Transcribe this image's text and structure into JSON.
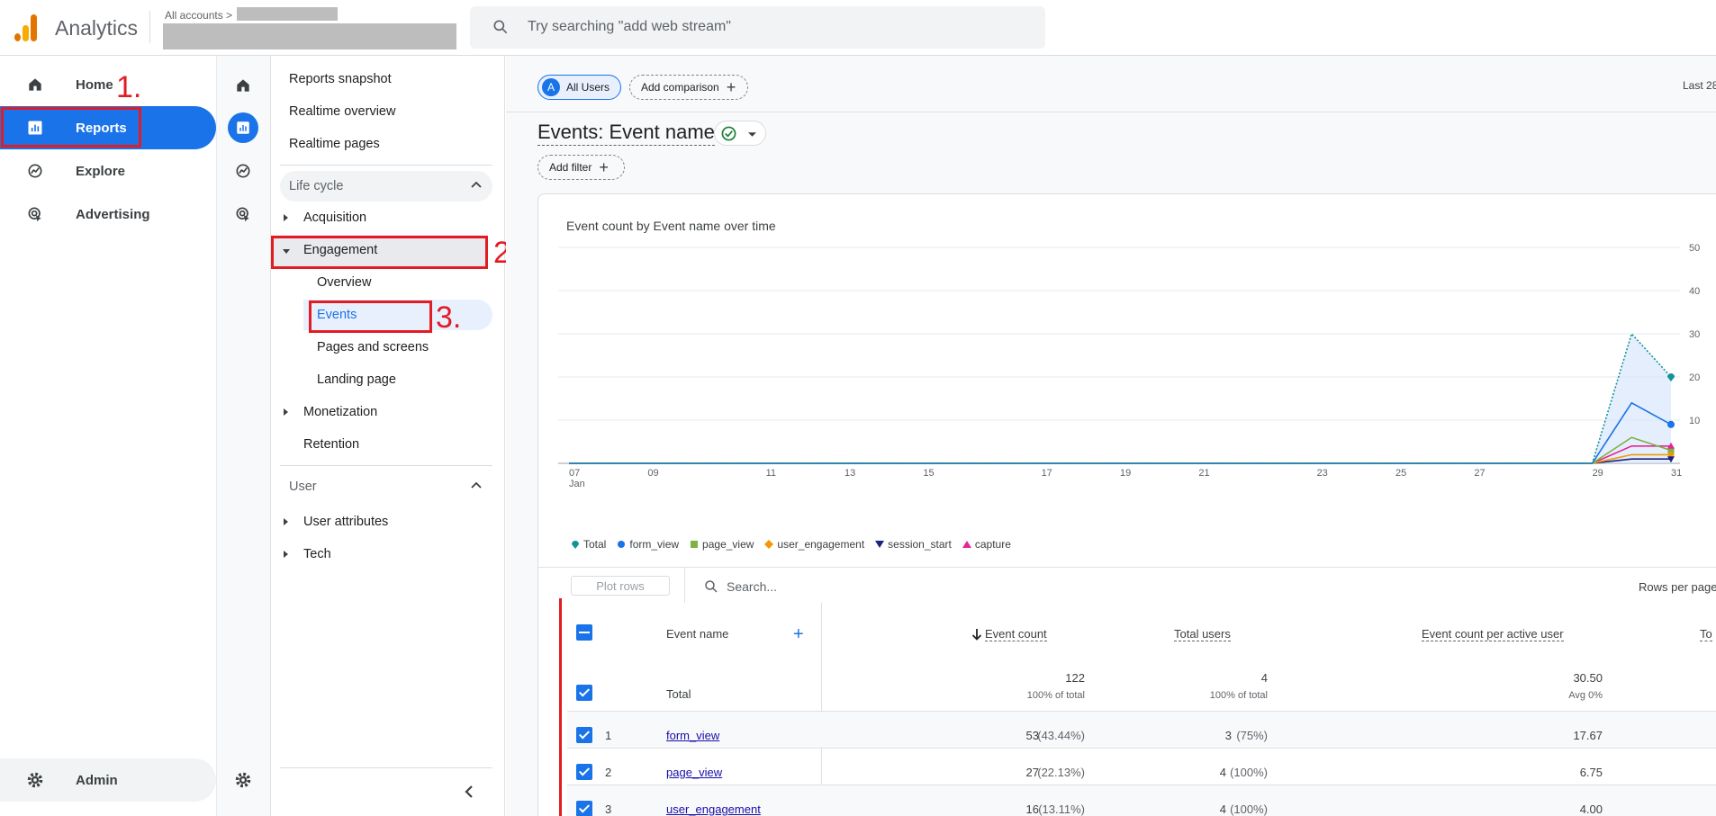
{
  "header": {
    "app_title": "Analytics",
    "breadcrumb": "All accounts >",
    "search_placeholder": "Try searching \"add web stream\""
  },
  "leftnav": {
    "items": [
      {
        "label": "Home",
        "icon": "home-icon"
      },
      {
        "label": "Reports",
        "icon": "reports-icon",
        "active": true
      },
      {
        "label": "Explore",
        "icon": "explore-icon"
      },
      {
        "label": "Advertising",
        "icon": "advertising-icon"
      }
    ],
    "admin_label": "Admin"
  },
  "annotations": [
    "1.",
    "2.",
    "3."
  ],
  "reports_sidebar": {
    "top_items": [
      "Reports snapshot",
      "Realtime overview",
      "Realtime pages"
    ],
    "lifecycle_label": "Life cycle",
    "lifecycle_items": {
      "acquisition": "Acquisition",
      "engagement": "Engagement",
      "overview": "Overview",
      "events": "Events",
      "pages_screens": "Pages and screens",
      "landing_page": "Landing page",
      "monetization": "Monetization",
      "retention": "Retention"
    },
    "user_label": "User",
    "user_items": [
      "User attributes",
      "Tech"
    ]
  },
  "main": {
    "segment_chip": "All Users",
    "segment_avatar": "A",
    "add_comparison": "Add comparison",
    "date_range": "Last 28",
    "page_title": "Events: Event name",
    "add_filter": "Add filter",
    "chart_title": "Event count by Event name over time",
    "search_placeholder": "Search...",
    "plot_rows": "Plot rows",
    "rows_per_page": "Rows per page:"
  },
  "chart_data": {
    "type": "line",
    "x": [
      "07 Jan",
      "09",
      "11",
      "13",
      "15",
      "17",
      "19",
      "21",
      "23",
      "25",
      "27",
      "29",
      "31"
    ],
    "x_ticks": [
      "07",
      "09",
      "11",
      "13",
      "15",
      "17",
      "19",
      "21",
      "23",
      "25",
      "27",
      "29",
      "31"
    ],
    "x_sub": "Jan",
    "y_ticks": [
      "50",
      "40",
      "30",
      "20",
      "10"
    ],
    "ylim": [
      0,
      50
    ],
    "series": [
      {
        "name": "Total",
        "color": "#12939a",
        "values": [
          0,
          0,
          0,
          0,
          0,
          0,
          0,
          0,
          0,
          0,
          0,
          0,
          0,
          0,
          0,
          0,
          0,
          0,
          0,
          0,
          0,
          0,
          0,
          0,
          0,
          0,
          0,
          30,
          20
        ]
      },
      {
        "name": "form_view",
        "color": "#1a73e8",
        "values": [
          0,
          0,
          0,
          0,
          0,
          0,
          0,
          0,
          0,
          0,
          0,
          0,
          0,
          0,
          0,
          0,
          0,
          0,
          0,
          0,
          0,
          0,
          0,
          0,
          0,
          0,
          0,
          14,
          9
        ]
      },
      {
        "name": "page_view",
        "color": "#7cb342",
        "values": [
          0,
          0,
          0,
          0,
          0,
          0,
          0,
          0,
          0,
          0,
          0,
          0,
          0,
          0,
          0,
          0,
          0,
          0,
          0,
          0,
          0,
          0,
          0,
          0,
          0,
          0,
          0,
          6,
          3
        ]
      },
      {
        "name": "user_engagement",
        "color": "#f29900",
        "values": [
          0,
          0,
          0,
          0,
          0,
          0,
          0,
          0,
          0,
          0,
          0,
          0,
          0,
          0,
          0,
          0,
          0,
          0,
          0,
          0,
          0,
          0,
          0,
          0,
          0,
          0,
          0,
          2,
          2
        ]
      },
      {
        "name": "session_start",
        "color": "#1a237e",
        "values": [
          0,
          0,
          0,
          0,
          0,
          0,
          0,
          0,
          0,
          0,
          0,
          0,
          0,
          0,
          0,
          0,
          0,
          0,
          0,
          0,
          0,
          0,
          0,
          0,
          0,
          0,
          0,
          1,
          1
        ]
      },
      {
        "name": "capture",
        "color": "#e52592",
        "values": [
          0,
          0,
          0,
          0,
          0,
          0,
          0,
          0,
          0,
          0,
          0,
          0,
          0,
          0,
          0,
          0,
          0,
          0,
          0,
          0,
          0,
          0,
          0,
          0,
          0,
          0,
          0,
          4,
          4
        ]
      }
    ]
  },
  "table": {
    "headers": {
      "event_name": "Event name",
      "event_count": "Event count",
      "total_users": "Total users",
      "per_user": "Event count per active user",
      "last": "To"
    },
    "total": {
      "label": "Total",
      "event_count": "122",
      "event_count_sub": "100% of total",
      "total_users": "4",
      "total_users_sub": "100% of total",
      "per_user": "30.50",
      "per_user_sub": "Avg 0%"
    },
    "rows": [
      {
        "n": "1",
        "name": "form_view",
        "count": "53",
        "count_pct": "(43.44%)",
        "users": "3",
        "users_pct": "(75%)",
        "per_user": "17.67"
      },
      {
        "n": "2",
        "name": "page_view",
        "count": "27",
        "count_pct": "(22.13%)",
        "users": "4",
        "users_pct": "(100%)",
        "per_user": "6.75"
      },
      {
        "n": "3",
        "name": "user_engagement",
        "count": "16",
        "count_pct": "(13.11%)",
        "users": "4",
        "users_pct": "(100%)",
        "per_user": "4.00"
      }
    ]
  }
}
